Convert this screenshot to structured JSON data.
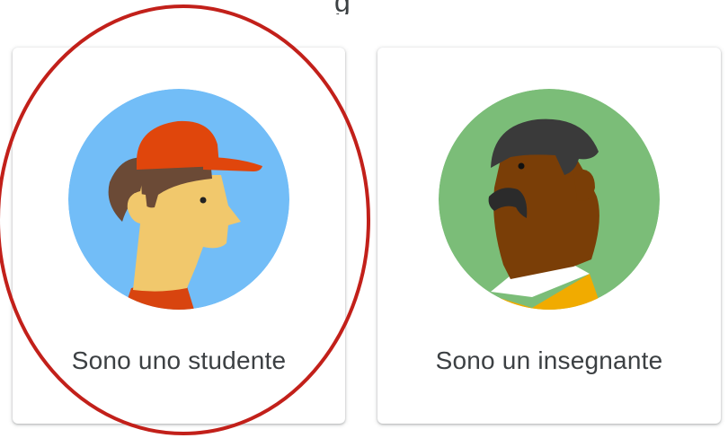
{
  "page": {
    "heading_fragment": "g"
  },
  "roles": [
    {
      "label": "Sono uno studente",
      "avatar": "student-avatar"
    },
    {
      "label": "Sono un insegnante",
      "avatar": "teacher-avatar"
    }
  ],
  "colors": {
    "student_bg": "#72bdf7",
    "student_cap": "#e0460c",
    "student_hair": "#6b4a36",
    "student_skin": "#f1c86c",
    "student_shirt": "#d8440f",
    "teacher_bg": "#7bbd78",
    "teacher_hair": "#3a3a3a",
    "teacher_skin": "#7a3e07",
    "teacher_collar": "#ffffff",
    "teacher_shirt": "#f1ab00",
    "annotation_ring": "#c2201a",
    "label_text": "#3c4043"
  }
}
